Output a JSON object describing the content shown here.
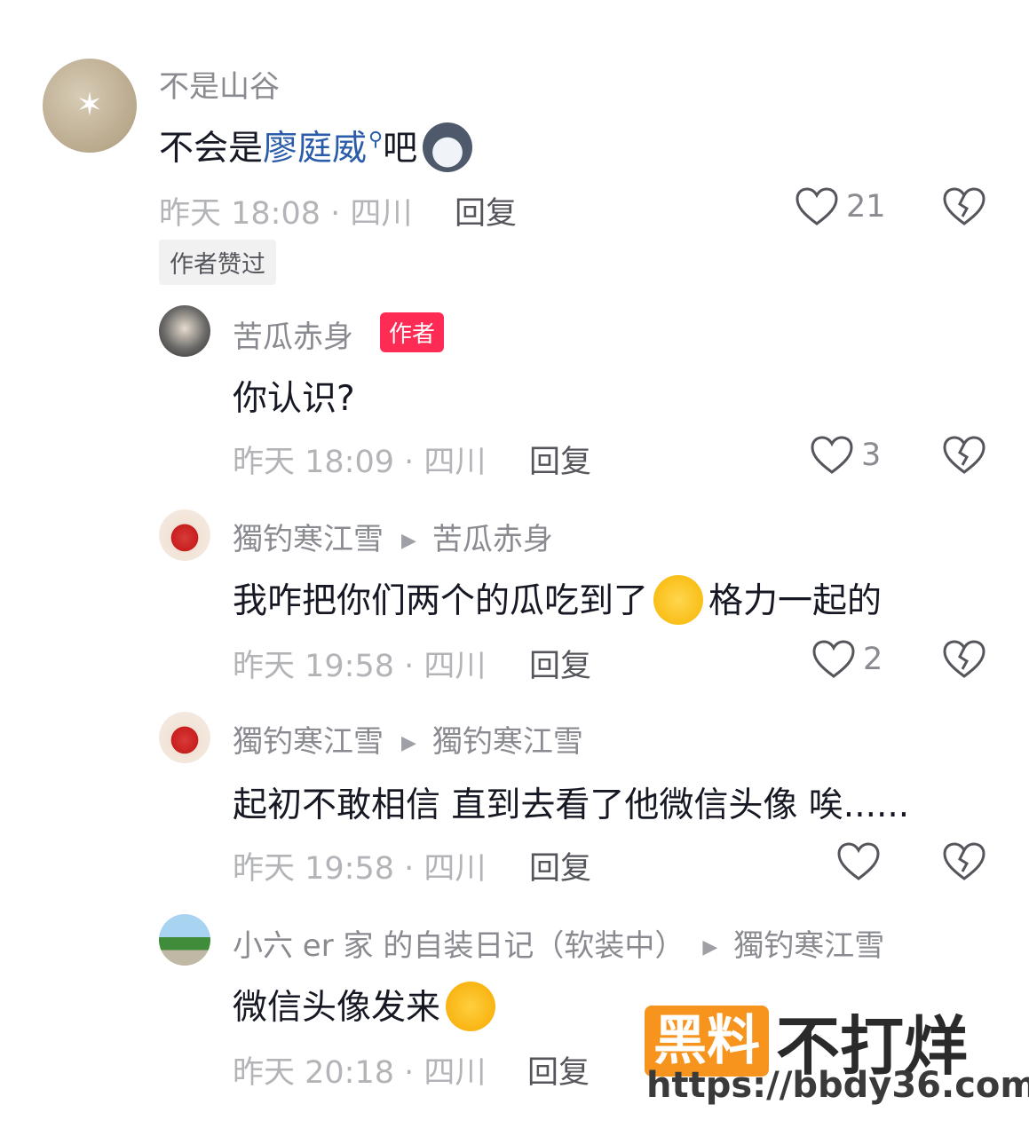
{
  "comments": [
    {
      "username": "不是山谷",
      "text_before": "不会是",
      "link": "廖庭威",
      "search_icon": "search-icon",
      "text_after": "吧",
      "emoji": "wolf-emoji",
      "time": "昨天 18:08 · 四川",
      "reply": "回复",
      "likes": "21",
      "badge": "作者赞过"
    },
    {
      "username": "苦瓜赤身",
      "tag": "作者",
      "text": "你认识?",
      "time": "昨天 18:09 · 四川",
      "reply": "回复",
      "likes": "3"
    },
    {
      "username": "獨钓寒江雪",
      "reply_to": "苦瓜赤身",
      "text_before": "我咋把你们两个的瓜吃到了",
      "emoji": "grin-sweat-emoji",
      "text_after": "格力一起的",
      "time": "昨天 19:58 · 四川",
      "reply": "回复",
      "likes": "2"
    },
    {
      "username": "獨钓寒江雪",
      "reply_to": "獨钓寒江雪",
      "text": "起初不敢相信 直到去看了他微信头像 唉......",
      "time": "昨天 19:58 · 四川",
      "reply": "回复",
      "likes": ""
    },
    {
      "username": "小六 er 家 的自装日记（软装中）",
      "reply_to": "獨钓寒江雪",
      "text": "微信头像发来",
      "emoji": "laugh-cry-emoji",
      "time": "昨天 20:18 · 四川",
      "reply": "回复",
      "likes": ""
    }
  ],
  "watermark": {
    "box": "黑料",
    "text": "不打烊",
    "url": "https://bbdy36.com"
  },
  "colors": {
    "link": "#2a5caa",
    "author_tag": "#fe2c55",
    "watermark_orange": "#f7941d"
  }
}
